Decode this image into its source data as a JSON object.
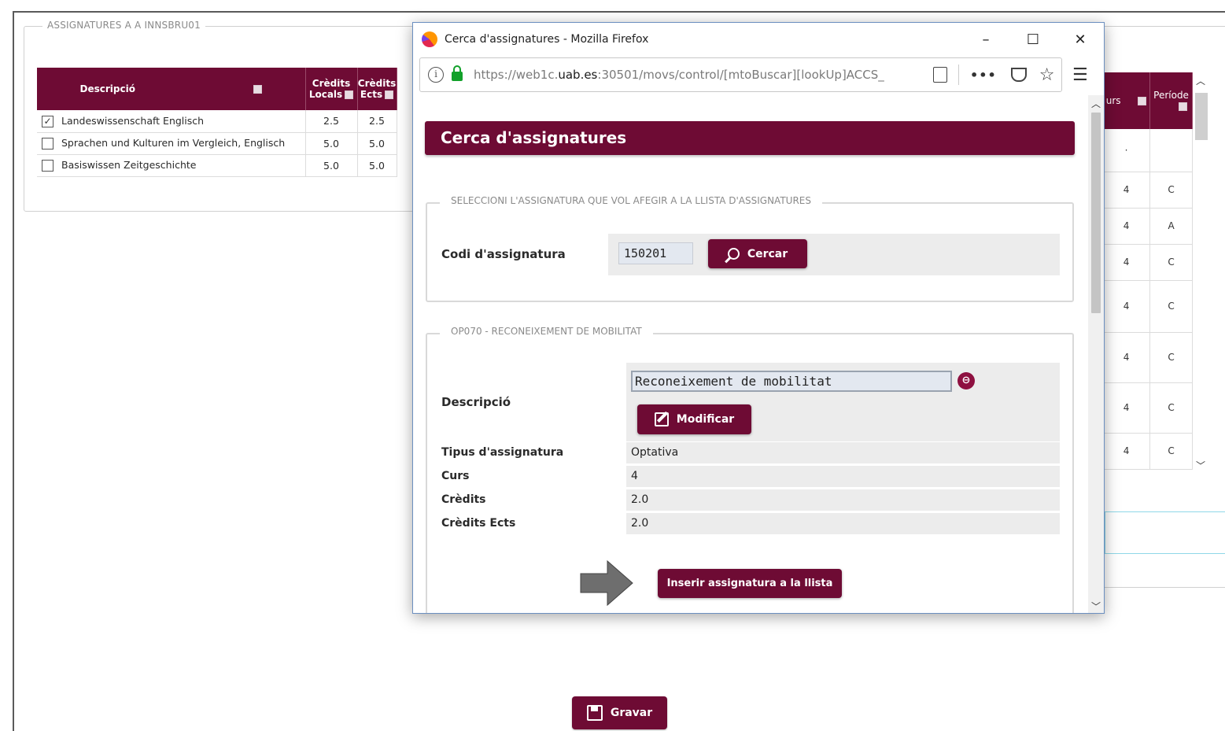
{
  "background": {
    "legend": "ASSIGNATURES A A INNSBRU01",
    "table": {
      "headers": [
        "Descripció",
        "Crèdits Locals",
        "Crèdits Ects"
      ],
      "rows": [
        {
          "checked": true,
          "desc": "Landeswissenschaft Englisch",
          "local": "2.5",
          "ects": "2.5"
        },
        {
          "checked": false,
          "desc": "Sprachen und Kulturen im Vergleich, Englisch",
          "local": "5.0",
          "ects": "5.0"
        },
        {
          "checked": false,
          "desc": "Basiswissen Zeitgeschichte",
          "local": "5.0",
          "ects": "5.0"
        }
      ]
    },
    "right_table": {
      "headers": [
        "urs",
        "Període"
      ],
      "rows": [
        [
          "·",
          ""
        ],
        [
          "4",
          "C"
        ],
        [
          "4",
          "A"
        ],
        [
          "4",
          "C"
        ],
        [
          "4",
          "C"
        ],
        [
          "4",
          "C"
        ],
        [
          "4",
          "C"
        ],
        [
          "4",
          "C"
        ]
      ]
    },
    "save_label": "Gravar"
  },
  "window": {
    "title": "Cerca d'assignatures - Mozilla Firefox",
    "url_prefix": "https://web1c.",
    "url_domain": "uab.es",
    "url_suffix": ":30501/movs/control/[mtoBuscar][lookUp]ACCS_",
    "controls": {
      "minimize": "–",
      "maximize": "☐",
      "close": "✕"
    }
  },
  "page": {
    "header": "Cerca d'assignatures",
    "search_section": {
      "legend": "SELECCIONI L'ASSIGNATURA QUE VOL AFEGIR A LA LLISTA D'ASSIGNATURES",
      "code_label": "Codi d'assignatura",
      "code_value": "150201",
      "search_label": "Cercar"
    },
    "result_section": {
      "legend": "OP070 - RECONEIXEMENT DE MOBILITAT",
      "desc_label": "Descripció",
      "desc_value": "Reconeixement de mobilitat",
      "modify_label": "Modificar",
      "fields": [
        {
          "label": "Tipus d'assignatura",
          "value": "Optativa"
        },
        {
          "label": "Curs",
          "value": "4"
        },
        {
          "label": "Crèdits",
          "value": "2.0"
        },
        {
          "label": "Crèdits Ects",
          "value": "2.0"
        }
      ],
      "insert_label": "Inserir assignatura a la llista"
    }
  },
  "colors": {
    "brand": "#6e0b34"
  }
}
